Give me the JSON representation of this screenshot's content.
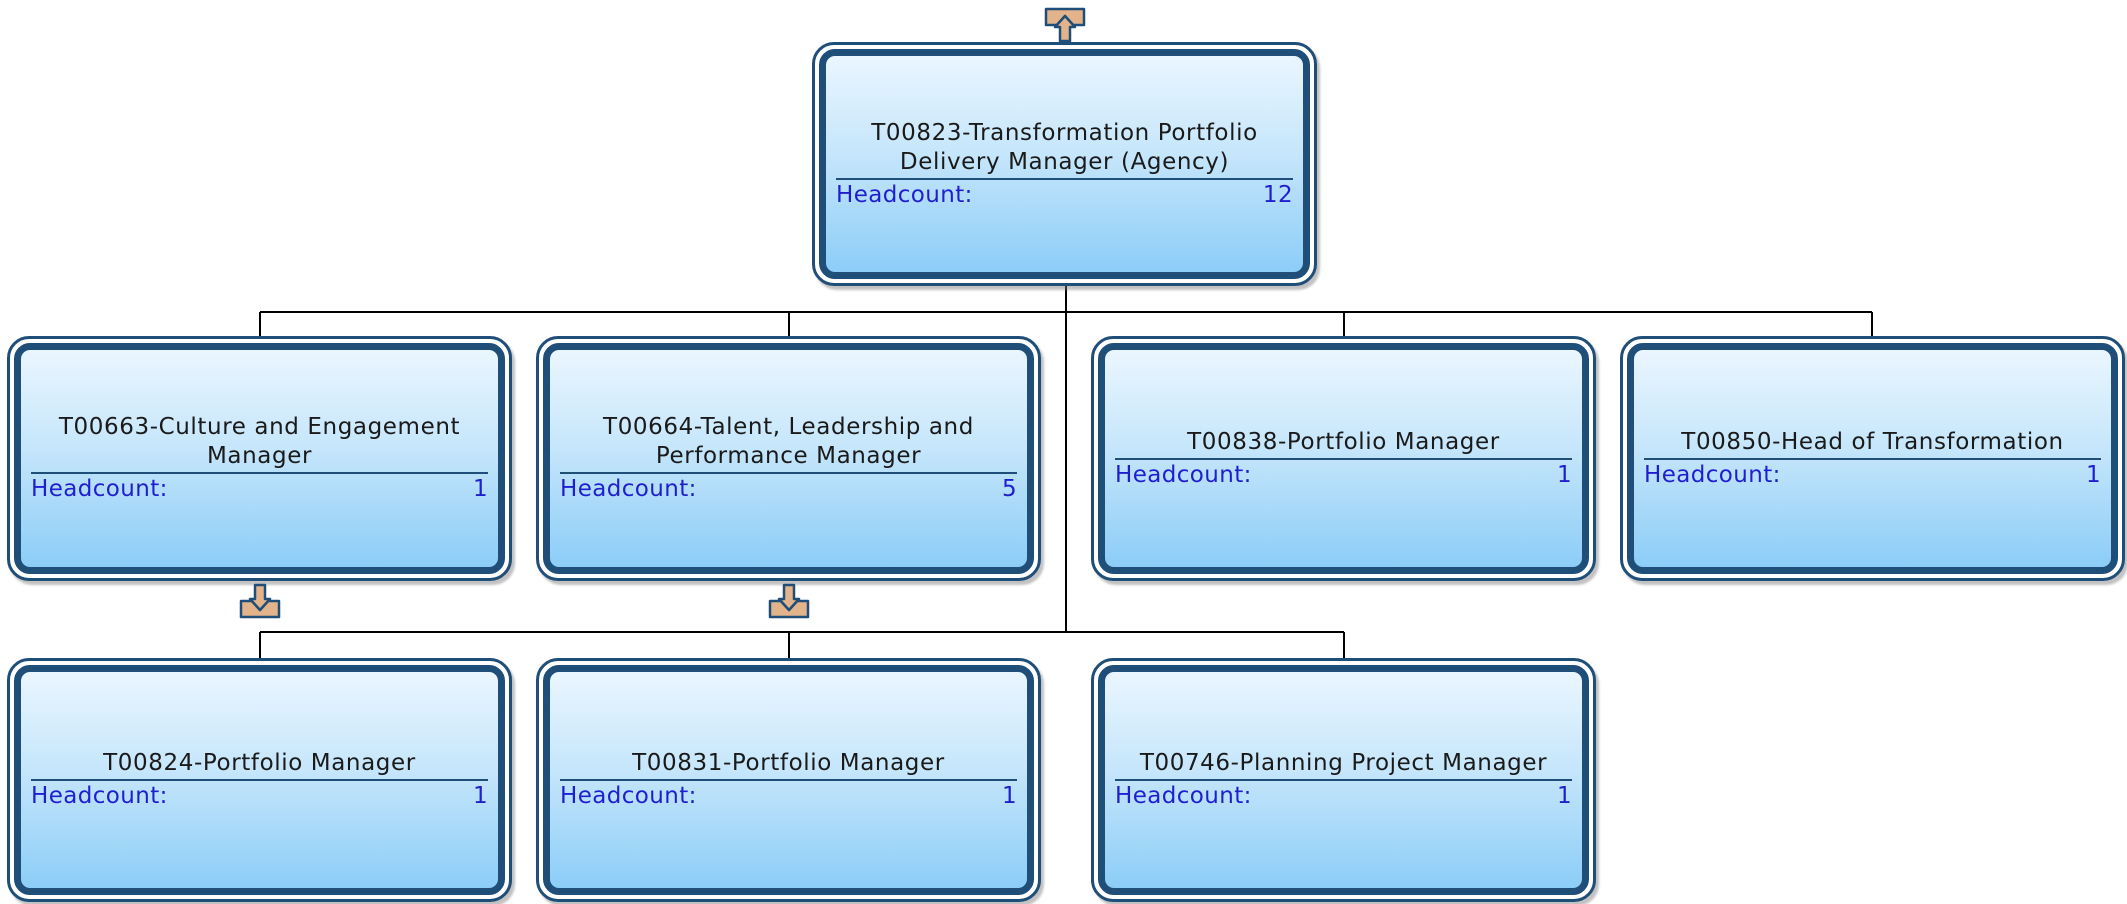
{
  "colors": {
    "node_border": "#1f4e79",
    "gradient_top": "#eaf6ff",
    "gradient_bottom": "#8ccdf7",
    "headcount_text": "#1f1fd0",
    "arrow_fill": "#e3b48c",
    "connector": "#000000"
  },
  "icons": {
    "expand_up": "arrow-up-icon",
    "expand_down": "arrow-down-icon"
  },
  "headcount_label": "Headcount:",
  "nodes": {
    "root": {
      "title": "T00823-Transformation Portfolio Delivery Manager (Agency)",
      "headcount": "12"
    },
    "n663": {
      "title": "T00663-Culture and Engagement Manager",
      "headcount": "1"
    },
    "n664": {
      "title": "T00664-Talent, Leadership and Performance Manager",
      "headcount": "5"
    },
    "n838": {
      "title": "T00838-Portfolio Manager",
      "headcount": "1"
    },
    "n850": {
      "title": "T00850-Head of Transformation",
      "headcount": "1"
    },
    "n824": {
      "title": "T00824-Portfolio Manager",
      "headcount": "1"
    },
    "n831": {
      "title": "T00831-Portfolio Manager",
      "headcount": "1"
    },
    "n746": {
      "title": "T00746-Planning Project Manager",
      "headcount": "1"
    }
  }
}
